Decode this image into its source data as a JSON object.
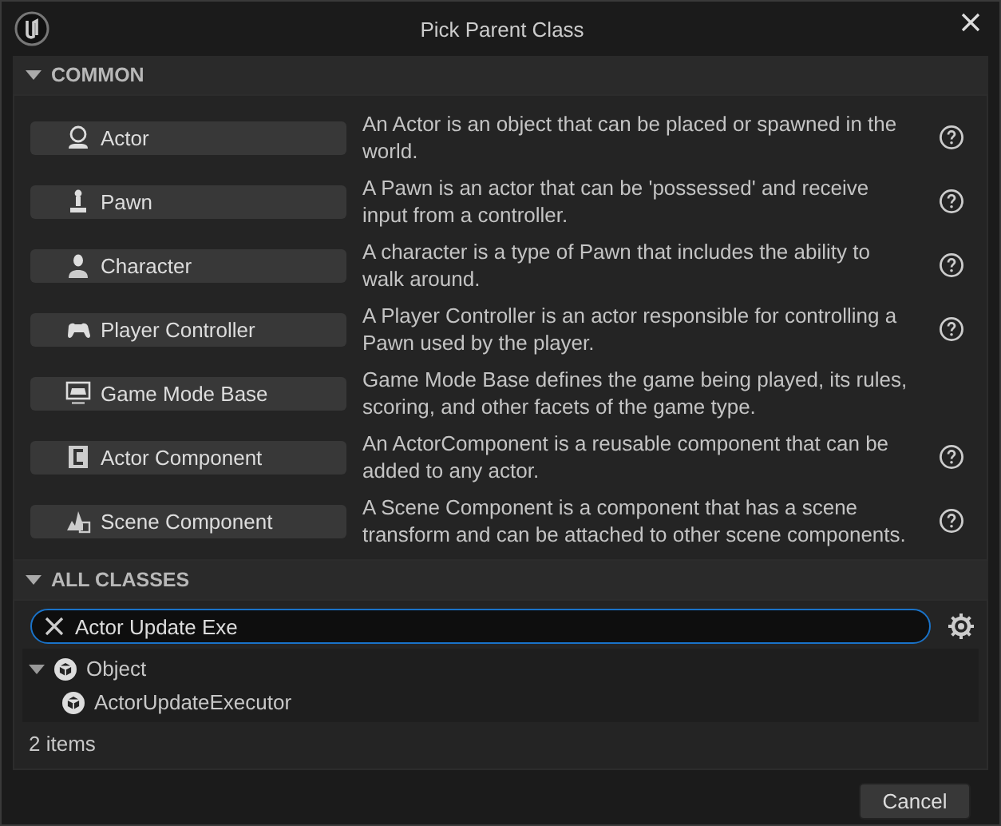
{
  "window": {
    "title": "Pick Parent Class"
  },
  "common": {
    "heading": "COMMON",
    "expanded": true,
    "items": [
      {
        "kind": "actor",
        "label": "Actor",
        "description": "An Actor is an object that can be placed or spawned in the world.",
        "help": true
      },
      {
        "kind": "pawn",
        "label": "Pawn",
        "description": "A Pawn is an actor that can be 'possessed' and receive input from a controller.",
        "help": true
      },
      {
        "kind": "character",
        "label": "Character",
        "description": "A character is a type of Pawn that includes the ability to walk around.",
        "help": true
      },
      {
        "kind": "controller",
        "label": "Player Controller",
        "description": "A Player Controller is an actor responsible for controlling a Pawn used by the player.",
        "help": true
      },
      {
        "kind": "gamemode",
        "label": "Game Mode Base",
        "description": "Game Mode Base defines the game being played, its rules, scoring, and other facets of the game type.",
        "help": false
      },
      {
        "kind": "component",
        "label": "Actor Component",
        "description": "An ActorComponent is a reusable component that can be added to any actor.",
        "help": true
      },
      {
        "kind": "scene",
        "label": "Scene Component",
        "description": "A Scene Component is a component that has a scene transform and can be attached to other scene components.",
        "help": true
      }
    ]
  },
  "all_classes": {
    "heading": "ALL CLASSES",
    "expanded": true,
    "search": {
      "value": "Actor Update Exe"
    },
    "tree": [
      {
        "label": "Object",
        "expanded": true,
        "children": [
          {
            "label": "ActorUpdateExecutor"
          }
        ]
      }
    ],
    "count": "2 items"
  },
  "buttons": [
    "Cancel"
  ]
}
